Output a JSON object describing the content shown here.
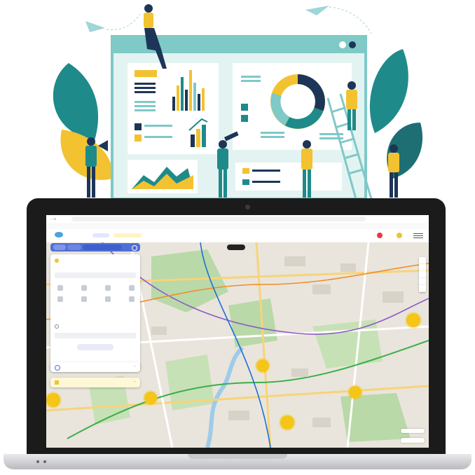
{
  "illustration": {
    "description_free": true
  },
  "browser": {
    "url": "",
    "bookmarks": [
      "",
      "",
      "",
      "",
      "",
      "",
      "",
      "",
      "",
      ""
    ]
  },
  "site": {
    "logo_text": "",
    "tabs": [
      "",
      "",
      ""
    ],
    "header_buttons": [
      "",
      "",
      ""
    ]
  },
  "map": {
    "clusters": [
      {
        "label": ""
      },
      {
        "label": ""
      },
      {
        "label": ""
      },
      {
        "label": ""
      },
      {
        "label": ""
      },
      {
        "label": ""
      },
      {
        "label": ""
      }
    ]
  },
  "panel": {
    "section1_title": "",
    "section2_title": "",
    "section3_title": "",
    "search_button": ""
  },
  "colors": {
    "accent_blue": "#4f6fd6",
    "cluster_yellow": "#f5c518",
    "teal": "#1f8a8a",
    "navy": "#1d3557"
  }
}
